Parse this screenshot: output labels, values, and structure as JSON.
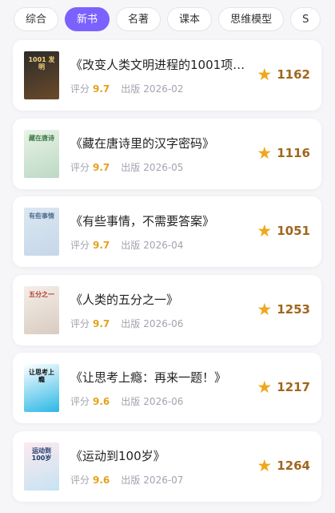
{
  "tabs": [
    {
      "label": "综合",
      "active": false
    },
    {
      "label": "新书",
      "active": true
    },
    {
      "label": "名著",
      "active": false
    },
    {
      "label": "课本",
      "active": false
    },
    {
      "label": "思维模型",
      "active": false
    },
    {
      "label": "S",
      "active": false
    }
  ],
  "meta_labels": {
    "score": "评分",
    "published": "出版"
  },
  "books": [
    {
      "title": "《改变人类文明进程的1001项…",
      "score": "9.7",
      "published": "2026-02",
      "favorites": "1162",
      "cover_text": "1001 发明",
      "cover_colors": [
        "#2b2b2b",
        "#6b4a2a"
      ],
      "cover_text_color": "#f2d27a"
    },
    {
      "title": "《藏在唐诗里的汉字密码》",
      "score": "9.7",
      "published": "2026-05",
      "favorites": "1116",
      "cover_text": "藏在唐诗",
      "cover_colors": [
        "#e9f3e6",
        "#bcd9c4"
      ],
      "cover_text_color": "#3f7a4b"
    },
    {
      "title": "《有些事情，不需要答案》",
      "score": "9.7",
      "published": "2026-04",
      "favorites": "1051",
      "cover_text": "有些事情",
      "cover_colors": [
        "#dbe7f2",
        "#c6d7ea"
      ],
      "cover_text_color": "#52708f"
    },
    {
      "title": "《人类的五分之一》",
      "score": "9.7",
      "published": "2026-06",
      "favorites": "1253",
      "cover_text": "五分之一",
      "cover_colors": [
        "#f4eee8",
        "#d9ccc0"
      ],
      "cover_text_color": "#b23a2c"
    },
    {
      "title": "《让思考上瘾：再来一题！》",
      "score": "9.6",
      "published": "2026-06",
      "favorites": "1217",
      "cover_text": "让思考上瘾",
      "cover_colors": [
        "#ffffff",
        "#2bb7e6"
      ],
      "cover_text_color": "#111111"
    },
    {
      "title": "《运动到100岁》",
      "score": "9.6",
      "published": "2026-07",
      "favorites": "1264",
      "cover_text": "运动到100岁",
      "cover_colors": [
        "#fde9ef",
        "#c6e3f2"
      ],
      "cover_text_color": "#1f3a6e"
    }
  ]
}
